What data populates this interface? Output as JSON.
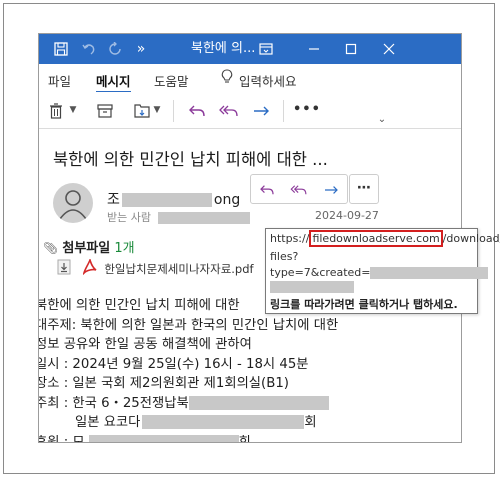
{
  "window": {
    "title": "북한에 의...",
    "chevrons": "»"
  },
  "menu": {
    "file": "파일",
    "message": "메시지",
    "help": "도움말",
    "tell_me": "입력하세요"
  },
  "message": {
    "subject": "북한에 의한 민간인 납치 피해에 대한 ...",
    "sender_prefix": "조",
    "sender_suffix": "ong",
    "to_label": "받는 사람",
    "date": "2024-09-27"
  },
  "attachments": {
    "label": "첨부파일",
    "count": "1개",
    "file_name": "한일납치문제세미나자자료.pdf"
  },
  "body": {
    "line1": "북한에 의한 민간인 납치 피해에 대한",
    "line2": "대주제: 북한에 의한 일본과 한국의 민간인 납치에 대한",
    "line3": "정보 공유와 한일 공동 해결책에 관하여",
    "line4": "일시 : 2024년 9월 25일(수) 16시 - 18시 45분",
    "line5": "장소 : 일본 국회 제2의원회관 제1회의실(B1)",
    "line6_prefix": "주최 : 한국 6・25전쟁납북",
    "line7_prefix": "일본 요코다",
    "line7_suffix": "회",
    "line8_prefix": "후원 : 모",
    "line8_suffix": "회"
  },
  "link_tooltip": {
    "scheme": "https://",
    "domain": "filedownloadserve.com",
    "path": "/download/",
    "path2": "files?",
    "query": "type=7&created=",
    "hint": "링크를 따라가려면 클릭하거나 탭하세요."
  },
  "colors": {
    "titlebar": "#2b6cc4",
    "accent": "#2b6cc4",
    "highlight": "#d41f1f",
    "attachment_count": "#1a8a3a"
  }
}
